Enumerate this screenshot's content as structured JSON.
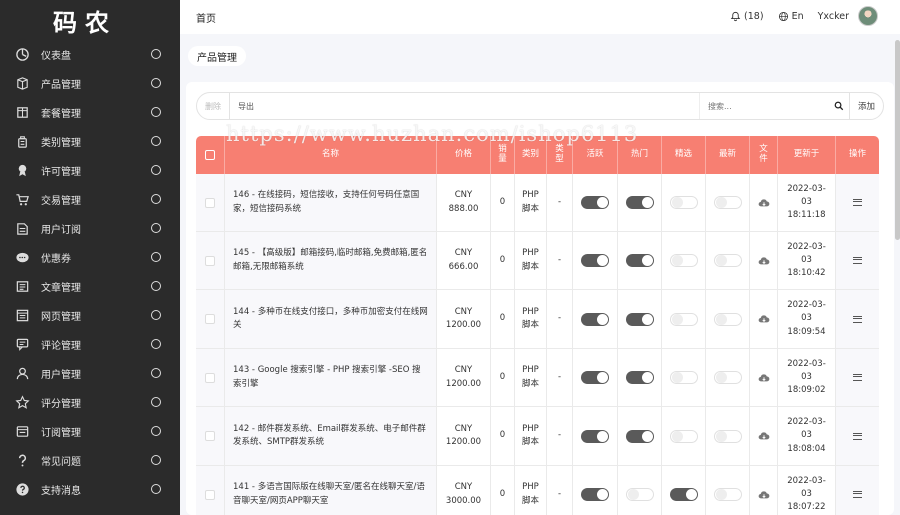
{
  "app": {
    "logo": "码农"
  },
  "sidebar": {
    "items": [
      {
        "label": "仪表盘",
        "icon": "dashboard-icon"
      },
      {
        "label": "产品管理",
        "icon": "cube-icon"
      },
      {
        "label": "套餐管理",
        "icon": "package-icon"
      },
      {
        "label": "类别管理",
        "icon": "category-icon"
      },
      {
        "label": "许可管理",
        "icon": "license-icon"
      },
      {
        "label": "交易管理",
        "icon": "cart-icon"
      },
      {
        "label": "用户订阅",
        "icon": "subscription-icon"
      },
      {
        "label": "优惠券",
        "icon": "coupon-icon"
      },
      {
        "label": "文章管理",
        "icon": "article-icon"
      },
      {
        "label": "网页管理",
        "icon": "webpage-icon"
      },
      {
        "label": "评论管理",
        "icon": "comment-icon"
      },
      {
        "label": "用户管理",
        "icon": "user-icon"
      },
      {
        "label": "评分管理",
        "icon": "star-icon"
      },
      {
        "label": "订阅管理",
        "icon": "subscribe-icon"
      },
      {
        "label": "常见问题",
        "icon": "question-icon"
      },
      {
        "label": "支持消息",
        "icon": "support-icon"
      }
    ]
  },
  "header": {
    "breadcrumb": "首页",
    "notifications": "(18)",
    "language": "En",
    "username": "Yxcker"
  },
  "tab": {
    "label": "产品管理"
  },
  "toolbar": {
    "delete_label": "删除",
    "export_label": "导出",
    "search_placeholder": "搜索...",
    "add_label": "添加"
  },
  "table": {
    "headers": {
      "name": "名称",
      "price": "价格",
      "sales": "销量",
      "category": "类别",
      "type": "类型",
      "active": "活跃",
      "hot": "热门",
      "featured": "精选",
      "new": "最新",
      "file": "文件",
      "updated": "更新于",
      "action": "操作"
    },
    "rows": [
      {
        "name": "146 - 在线接码，短信接收，支持任何号码任意国家，短信接码系统",
        "price_cur": "CNY",
        "price_val": "888.00",
        "sales": "0",
        "cat1": "PHP",
        "cat2": "脚本",
        "type": "-",
        "active": true,
        "hot": true,
        "featured": false,
        "new": false,
        "date": "2022-03-",
        "date2": "03",
        "time": "18:11:18"
      },
      {
        "name": "145 - 【高级版】邮箱接码,临时邮箱,免费邮箱,匿名邮箱,无限邮箱系统",
        "price_cur": "CNY",
        "price_val": "666.00",
        "sales": "0",
        "cat1": "PHP",
        "cat2": "脚本",
        "type": "-",
        "active": true,
        "hot": true,
        "featured": false,
        "new": false,
        "date": "2022-03-",
        "date2": "03",
        "time": "18:10:42"
      },
      {
        "name": "144 - 多种币在线支付接口，多种币加密支付在线网关",
        "price_cur": "CNY",
        "price_val": "1200.00",
        "sales": "0",
        "cat1": "PHP",
        "cat2": "脚本",
        "type": "-",
        "active": true,
        "hot": true,
        "featured": false,
        "new": false,
        "date": "2022-03-",
        "date2": "03",
        "time": "18:09:54"
      },
      {
        "name": "143 - Google 搜索引擎 - PHP 搜索引擎 -SEO 搜索引擎",
        "price_cur": "CNY",
        "price_val": "1200.00",
        "sales": "0",
        "cat1": "PHP",
        "cat2": "脚本",
        "type": "-",
        "active": true,
        "hot": true,
        "featured": false,
        "new": false,
        "date": "2022-03-",
        "date2": "03",
        "time": "18:09:02"
      },
      {
        "name": "142 - 邮件群发系统、Email群发系统、电子邮件群发系统、SMTP群发系统",
        "price_cur": "CNY",
        "price_val": "1200.00",
        "sales": "0",
        "cat1": "PHP",
        "cat2": "脚本",
        "type": "-",
        "active": true,
        "hot": true,
        "featured": false,
        "new": false,
        "date": "2022-03-",
        "date2": "03",
        "time": "18:08:04"
      },
      {
        "name": "141 - 多语言国际版在线聊天室/匿名在线聊天室/语音聊天室/网页APP聊天室",
        "price_cur": "CNY",
        "price_val": "3000.00",
        "sales": "0",
        "cat1": "PHP",
        "cat2": "脚本",
        "type": "-",
        "active": true,
        "hot": false,
        "featured": true,
        "new": false,
        "date": "2022-03-",
        "date2": "03",
        "time": "18:07:22"
      }
    ]
  },
  "watermark": "https://www.huzhan.com/ishop6113",
  "colors": {
    "table_header": "#f77f72",
    "sidebar_bg": "#2b2b2b",
    "switch_on": "#5a5a5a"
  }
}
